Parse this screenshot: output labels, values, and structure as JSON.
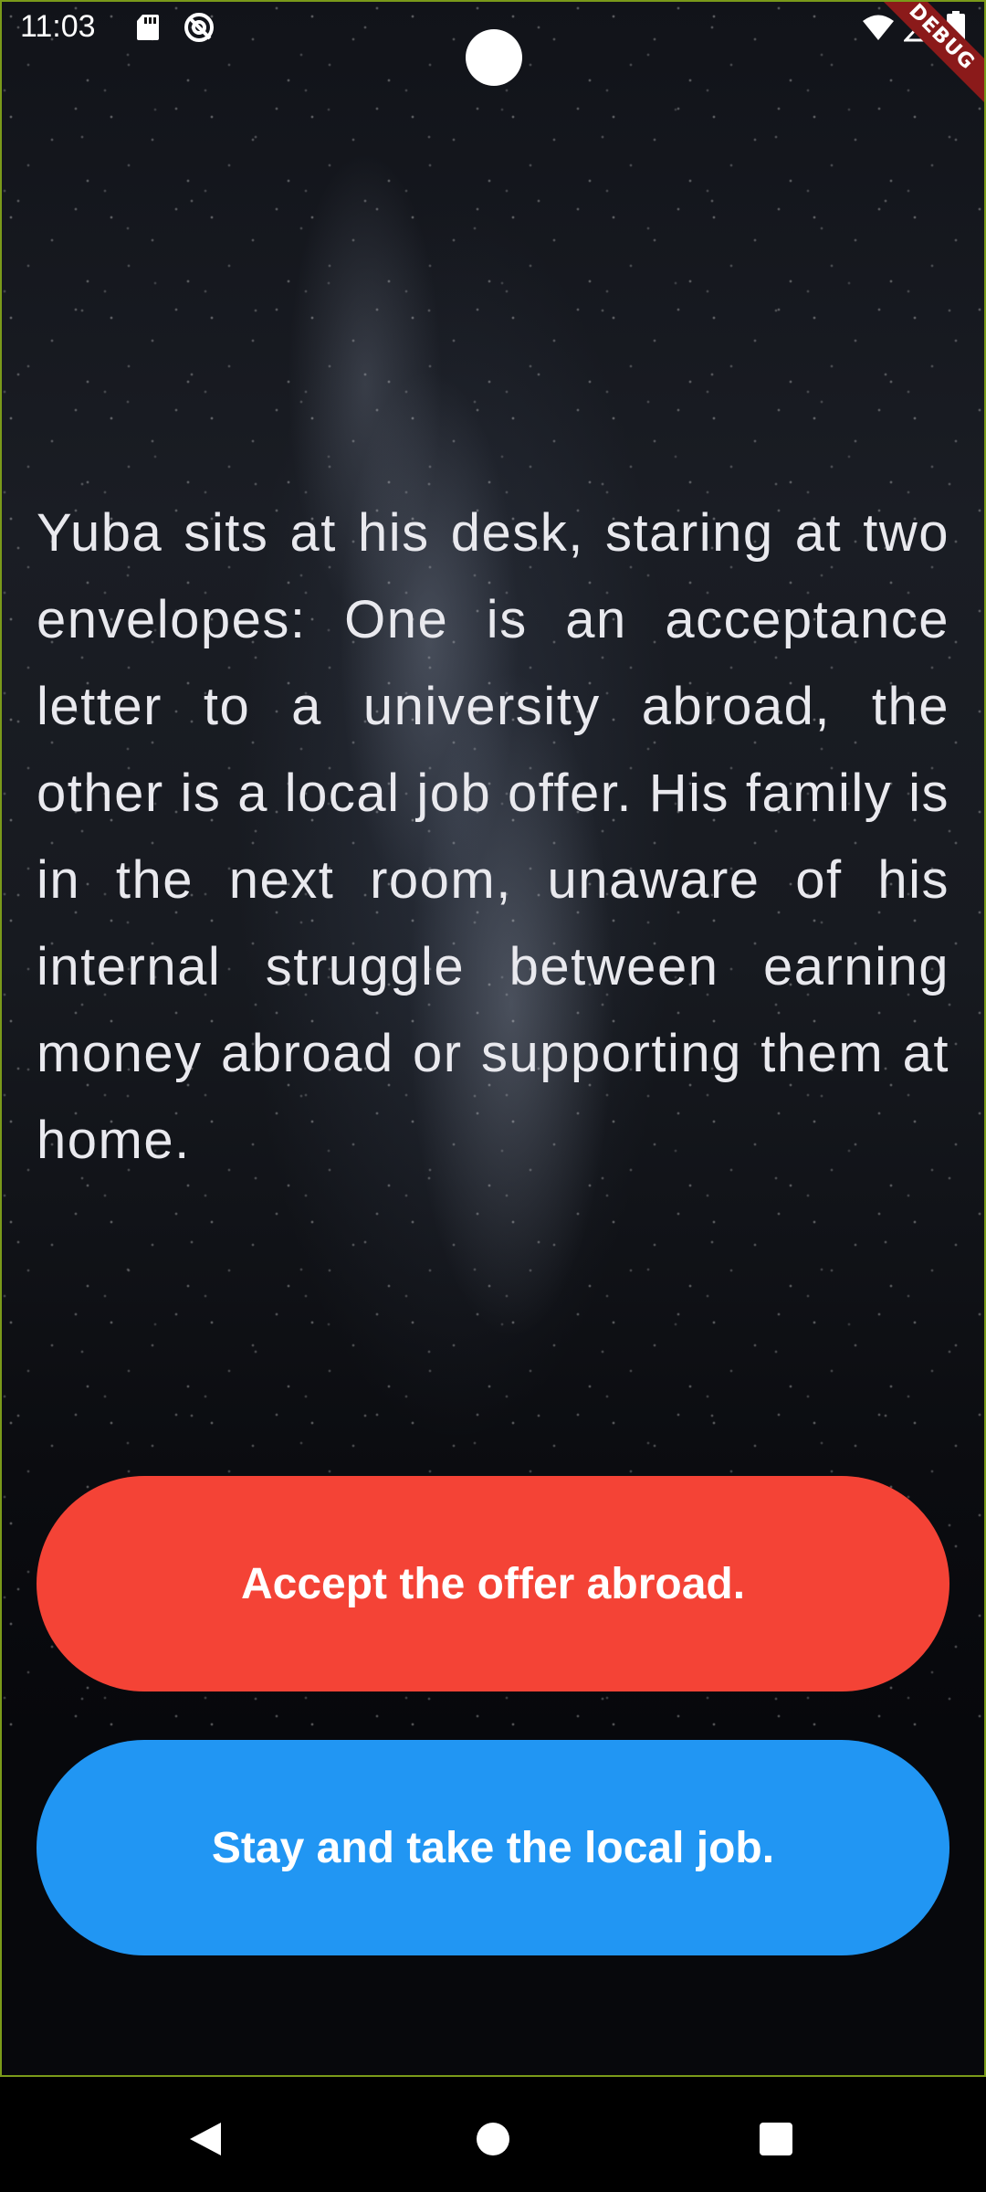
{
  "status_bar": {
    "time": "11:03",
    "icons": [
      "sd-card-icon",
      "no-data-saver-icon",
      "wifi-icon",
      "signal-icon",
      "battery-icon"
    ]
  },
  "debug_banner": {
    "label": "DEBUG"
  },
  "story": {
    "text": "Yuba sits at his desk, staring at two envelopes: One is an acceptance letter to a university abroad, the other is a local job offer. His family is in the next room, unaware of his internal struggle between earning money abroad or supporting them at home."
  },
  "choices": [
    {
      "label": "Accept the offer abroad.",
      "color": "#f44336"
    },
    {
      "label": "Stay and take the local job.",
      "color": "#2196f3"
    }
  ],
  "nav_bar": {
    "buttons": [
      "back-icon",
      "home-icon",
      "recents-icon"
    ]
  }
}
